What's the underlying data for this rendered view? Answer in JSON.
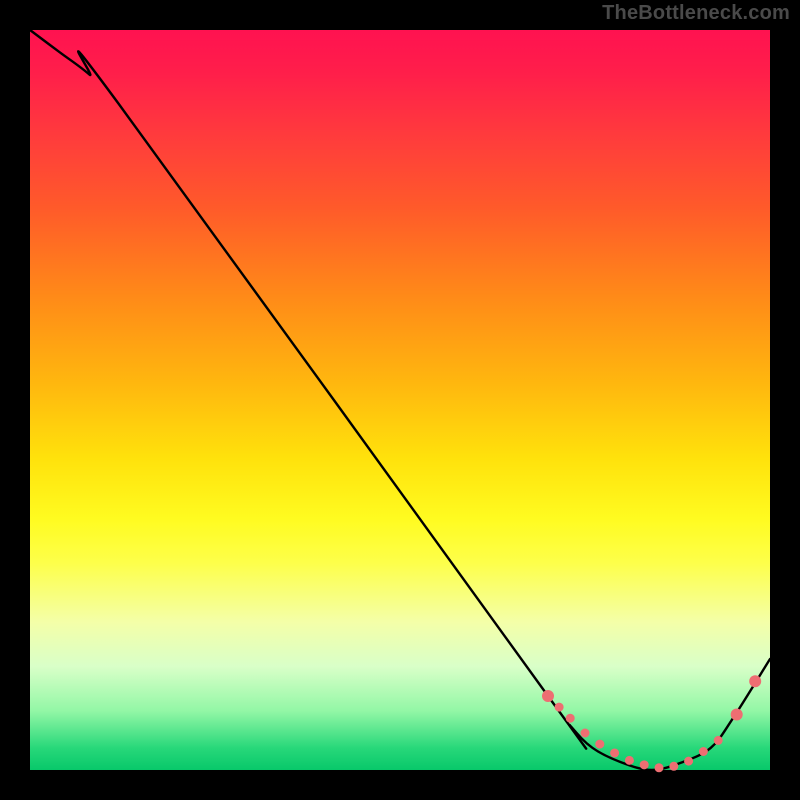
{
  "watermark": "TheBottleneck.com",
  "chart_data": {
    "type": "line",
    "title": "",
    "xlabel": "",
    "ylabel": "",
    "xlim": [
      0,
      100
    ],
    "ylim": [
      0,
      100
    ],
    "series": [
      {
        "name": "bottleneck-curve",
        "x": [
          0,
          4,
          8,
          12,
          70,
          73,
          76,
          80,
          84,
          88,
          92,
          95,
          100
        ],
        "y": [
          100,
          97,
          94,
          90,
          10,
          6,
          3,
          1,
          0,
          1,
          3,
          7,
          15
        ]
      }
    ],
    "markers": {
      "name": "highlight-points",
      "x": [
        70,
        71.5,
        73,
        75,
        77,
        79,
        81,
        83,
        85,
        87,
        89,
        91,
        93,
        95.5,
        98
      ],
      "y": [
        10,
        8.5,
        7,
        5,
        3.5,
        2.3,
        1.3,
        0.7,
        0.3,
        0.5,
        1.2,
        2.5,
        4,
        7.5,
        12
      ],
      "color": "#ee6e72",
      "radius_small": 4.5,
      "radius_large": 6
    },
    "colors": {
      "curve": "#000000",
      "marker": "#ee6e72",
      "background_top": "#ff1250",
      "background_bottom": "#08c86a"
    }
  }
}
